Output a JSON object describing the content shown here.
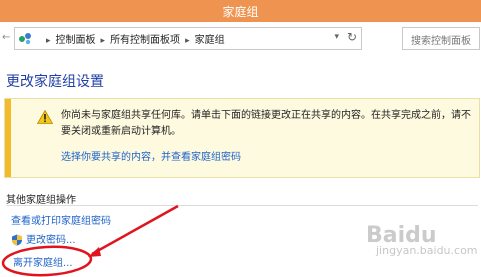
{
  "window": {
    "title": "家庭组"
  },
  "address": {
    "crumbs": [
      "控制面板",
      "所有控制面板项",
      "家庭组"
    ],
    "search_placeholder": "搜索控制面板"
  },
  "main": {
    "heading": "更改家庭组设置",
    "warning": {
      "message": "你尚未与家庭组共享任何库。请单击下面的链接更改正在共享的内容。在共享完成之前，请不要关闭或重新启动计算机。",
      "link": "选择你要共享的内容，并查看家庭组密码"
    },
    "other_actions": {
      "title": "其他家庭组操作",
      "items": [
        "查看或打印家庭组密码",
        "更改密码...",
        "离开家庭组..."
      ]
    }
  },
  "watermark": {
    "main": "Baidu",
    "sub": "jingyan.baidu.com"
  },
  "colors": {
    "titlebar": "#ef9450",
    "link": "#1d62c9",
    "heading": "#1f3fa6",
    "annotation": "#e0141e",
    "warning_stripe": "#f3ba2c"
  },
  "icons": [
    "back-arrow-icon",
    "forward-arrow-icon",
    "homegroup-icon",
    "chevron-down-icon",
    "refresh-icon",
    "warning-icon",
    "uac-shield-icon"
  ]
}
